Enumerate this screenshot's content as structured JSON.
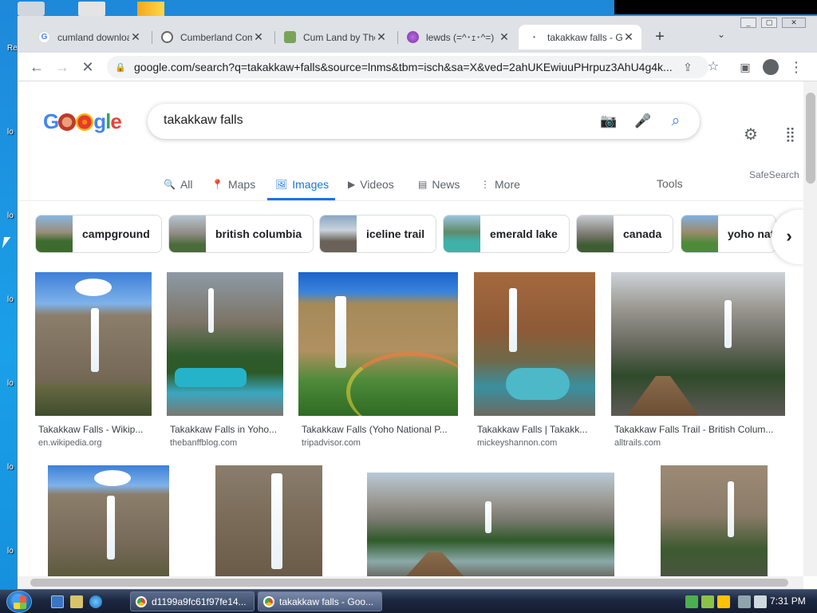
{
  "browser": {
    "tabs": [
      {
        "title": "cumland download"
      },
      {
        "title": "Cumberland Com"
      },
      {
        "title": "Cum Land by The"
      },
      {
        "title": "lewds (=^･ｪ･^=)"
      },
      {
        "title": "takakkaw falls - Google"
      }
    ],
    "new_tab": "+",
    "tab_menu": "⌄",
    "url": "google.com/search?q=takakkaw+falls&source=lnms&tbm=isch&sa=X&ved=2ahUKEwiuuPHrpuz3AhU4g4k..."
  },
  "google": {
    "query": "takakkaw falls",
    "nav": [
      "All",
      "Maps",
      "Images",
      "Videos",
      "News",
      "More"
    ],
    "tools": "Tools",
    "safesearch": "SafeSearch",
    "chips": [
      "campground",
      "british columbia",
      "iceline trail",
      "emerald lake",
      "canada",
      "yoho nat"
    ],
    "results": [
      {
        "caption": "Takakkaw Falls - Wikip...",
        "source": "en.wikipedia.org"
      },
      {
        "caption": "Takakkaw Falls in Yoho...",
        "source": "thebanffblog.com"
      },
      {
        "caption": "Takakkaw Falls (Yoho National P...",
        "source": "tripadvisor.com"
      },
      {
        "caption": "Takakkaw Falls | Takakk...",
        "source": "mickeyshannon.com"
      },
      {
        "caption": "Takakkaw Falls Trail - British Colum...",
        "source": "alltrails.com"
      }
    ]
  },
  "taskbar": {
    "tasks": [
      "d1199a9fc61f97fe14...",
      "takakkaw falls - Goo..."
    ],
    "clock": "7:31 PM"
  },
  "colors": {
    "google_blue": "#1a73e8",
    "desktop": "#1e88d9"
  }
}
